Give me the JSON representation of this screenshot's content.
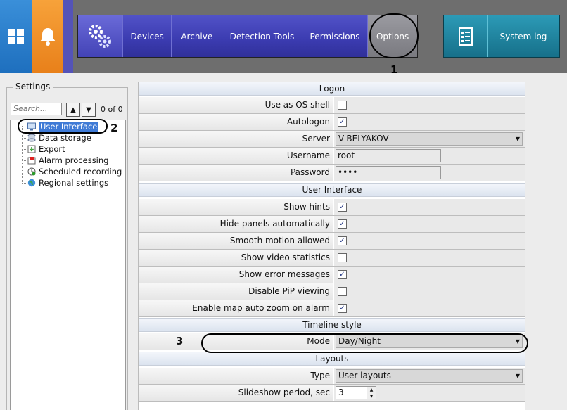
{
  "nav": {
    "devices": "Devices",
    "archive": "Archive",
    "detection": "Detection Tools",
    "permissions": "Permissions",
    "options": "Options",
    "system_log": "System log"
  },
  "callouts": {
    "one": "1",
    "two": "2",
    "three": "3"
  },
  "settings": {
    "title": "Settings",
    "search_placeholder": "Search...",
    "count": "0 of 0",
    "tree": [
      {
        "label": "User Interface",
        "icon": "monitor-icon",
        "selected": true
      },
      {
        "label": "Data storage",
        "icon": "database-icon"
      },
      {
        "label": "Export",
        "icon": "export-icon"
      },
      {
        "label": "Alarm processing",
        "icon": "alarm-icon"
      },
      {
        "label": "Scheduled recording",
        "icon": "clock-icon"
      },
      {
        "label": "Regional settings",
        "icon": "globe-icon"
      }
    ]
  },
  "logon": {
    "section": "Logon",
    "use_os_shell": {
      "label": "Use as OS shell",
      "checked": false
    },
    "autologon": {
      "label": "Autologon",
      "checked": true
    },
    "server": {
      "label": "Server",
      "value": "V-BELYAKOV"
    },
    "username": {
      "label": "Username",
      "value": "root"
    },
    "password": {
      "label": "Password",
      "value": "••••"
    }
  },
  "ui": {
    "section": "User Interface",
    "show_hints": {
      "label": "Show hints",
      "checked": true
    },
    "hide_panels": {
      "label": "Hide panels automatically",
      "checked": true
    },
    "smooth_motion": {
      "label": "Smooth motion allowed",
      "checked": true
    },
    "video_stats": {
      "label": "Show video statistics",
      "checked": false
    },
    "error_messages": {
      "label": "Show error messages",
      "checked": true
    },
    "disable_pip": {
      "label": "Disable PiP viewing",
      "checked": false
    },
    "map_zoom": {
      "label": "Enable map auto zoom on alarm",
      "checked": true
    }
  },
  "timeline": {
    "section": "Timeline style",
    "mode": {
      "label": "Mode",
      "value": "Day/Night"
    }
  },
  "layouts": {
    "section": "Layouts",
    "type": {
      "label": "Type",
      "value": "User layouts"
    },
    "slideshow": {
      "label": "Slideshow period, sec",
      "value": "3"
    }
  },
  "glyphs": {
    "check": "✓",
    "caret": "▼",
    "up": "▲",
    "down": "▼"
  }
}
